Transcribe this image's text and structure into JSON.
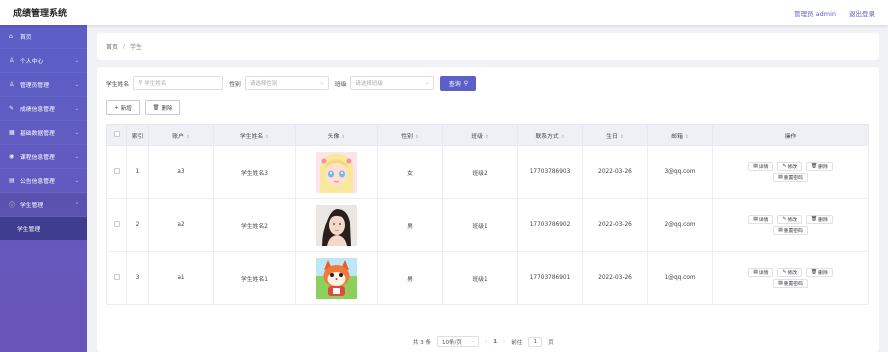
{
  "app": {
    "title": "成绩管理系统",
    "admin": "管理员 admin",
    "logout": "退出登录"
  },
  "sidebar": {
    "items": [
      {
        "label": "首页",
        "icon": "home-icon",
        "has_children": false
      },
      {
        "label": "个人中心",
        "icon": "user-icon",
        "has_children": true
      },
      {
        "label": "管理员管理",
        "icon": "user-icon",
        "has_children": true
      },
      {
        "label": "成绩信息管理",
        "icon": "edit-icon",
        "has_children": true
      },
      {
        "label": "基础数据管理",
        "icon": "grid-icon",
        "has_children": true
      },
      {
        "label": "课程信息管理",
        "icon": "location-icon",
        "has_children": true
      },
      {
        "label": "公告信息管理",
        "icon": "document-icon",
        "has_children": true
      },
      {
        "label": "学生管理",
        "icon": "info-icon",
        "has_children": true
      }
    ],
    "sub_active": "学生管理"
  },
  "breadcrumb": {
    "home": "首页",
    "sep": "/",
    "current": "学生"
  },
  "search": {
    "name_label": "学生姓名",
    "name_placeholder": "学生姓名",
    "gender_label": "性别",
    "gender_placeholder": "请选择性别",
    "class_label": "班级",
    "class_placeholder": "请选择班级",
    "query_btn": "查询"
  },
  "actions": {
    "add": "新增",
    "delete": "删除"
  },
  "table": {
    "headers": [
      "索引",
      "账户",
      "学生姓名",
      "头像",
      "性别",
      "班级",
      "联系方式",
      "生日",
      "邮箱",
      "操作"
    ],
    "rows": [
      {
        "index": "1",
        "account": "a3",
        "name": "学生姓名3",
        "gender": "女",
        "class": "班级2",
        "phone": "17703786903",
        "birthday": "2022-03-26",
        "email": "3@qq.com"
      },
      {
        "index": "2",
        "account": "a2",
        "name": "学生姓名2",
        "gender": "男",
        "class": "班级1",
        "phone": "17703786902",
        "birthday": "2022-03-26",
        "email": "2@qq.com"
      },
      {
        "index": "3",
        "account": "a1",
        "name": "学生姓名1",
        "gender": "男",
        "class": "班级1",
        "phone": "17703786901",
        "birthday": "2022-03-26",
        "email": "1@qq.com"
      }
    ],
    "ops": {
      "detail": "详情",
      "edit": "修改",
      "delete": "删除",
      "reset": "重置密码"
    }
  },
  "pager": {
    "total": "共 3 条",
    "page_size": "10条/页",
    "current": "1",
    "goto_label": "前往",
    "goto_value": "1",
    "page_unit": "页"
  },
  "colors": {
    "accent": "#5b5fc7",
    "sidebar_active": "#3f3d8f"
  }
}
